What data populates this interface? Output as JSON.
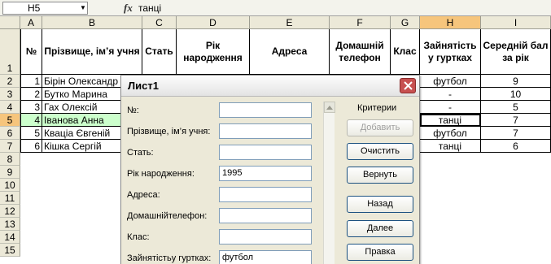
{
  "formula_bar": {
    "cell_ref": "H5",
    "fx": "fx",
    "content": "танці"
  },
  "columns": [
    "A",
    "B",
    "C",
    "D",
    "E",
    "F",
    "G",
    "H",
    "I"
  ],
  "rows": [
    "1",
    "2",
    "3",
    "4",
    "5",
    "6",
    "7",
    "8",
    "9",
    "10",
    "11",
    "12",
    "13",
    "14",
    "15"
  ],
  "table": {
    "headers": [
      "№",
      "Прізвище, ім’я учня",
      "Стать",
      "Рік народження",
      "Адреса",
      "Домашній телефон",
      "Клас",
      "Зайнятість у гуртках",
      "Середній бал за рік"
    ],
    "records": [
      {
        "num": "1",
        "name": "Бірін Олександр",
        "activity": "футбол",
        "score": "9"
      },
      {
        "num": "2",
        "name": "Бутко Марина",
        "activity": "-",
        "score": "10"
      },
      {
        "num": "3",
        "name": "Гах Олексій",
        "activity": "-",
        "score": "5"
      },
      {
        "num": "4",
        "name": "Іванова Анна",
        "activity": "танці",
        "score": "7"
      },
      {
        "num": "5",
        "name": "Кваціа Євгеній",
        "activity": "футбол",
        "score": "7"
      },
      {
        "num": "6",
        "name": "Кішка Сергій",
        "activity": "танці",
        "score": "6"
      }
    ]
  },
  "dialog": {
    "title": "Лист1",
    "fields": [
      {
        "label": "№:",
        "value": ""
      },
      {
        "label": "Прізвище,  ім’я учня:",
        "value": ""
      },
      {
        "label": "Стать:",
        "value": ""
      },
      {
        "label": "Рік народження:",
        "value": "1995"
      },
      {
        "label": "Адреса:",
        "value": ""
      },
      {
        "label": "Домашнійтелефон:",
        "value": ""
      },
      {
        "label": "Клас:",
        "value": ""
      },
      {
        "label": "Зайнятістьу гуртках:",
        "value": "футбол"
      }
    ],
    "criteria_label": "Критерии",
    "buttons": {
      "add": "Добавить",
      "clear": "Очистить",
      "restore": "Вернуть",
      "back": "Назад",
      "next": "Далее",
      "edit": "Правка"
    }
  },
  "colors": {
    "header_selected": "#f6c57c",
    "highlight_fill": "#ccffcc",
    "close_button": "#c75050"
  }
}
